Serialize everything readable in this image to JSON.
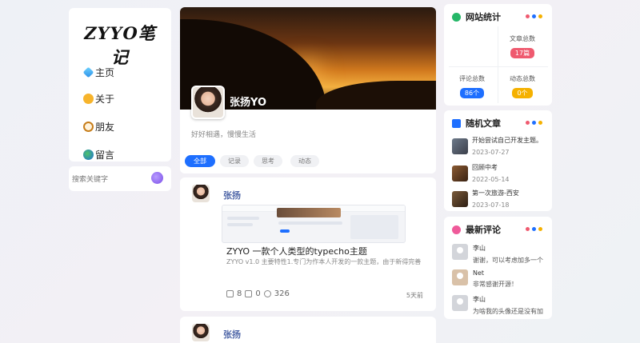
{
  "logo": "ZYYO笔记",
  "nav": [
    {
      "label": "主页",
      "icon": "diamond-icon"
    },
    {
      "label": "关于",
      "icon": "smiley-icon"
    },
    {
      "label": "朋友",
      "icon": "clock-icon"
    },
    {
      "label": "留言",
      "icon": "globe-icon"
    }
  ],
  "search": {
    "placeholder": "搜索关键字"
  },
  "profile": {
    "name": "张扬YO",
    "bio": "好好相遇，慢慢生活"
  },
  "tabs": [
    "全部",
    "记录",
    "思考",
    "动态"
  ],
  "posts": [
    {
      "author": "张扬",
      "title": "ZYYO 一款个人类型的typecho主题",
      "excerpt": "ZYYO v1.0 主要特性1.专门为作本人开发的一款主题，由于新得完善",
      "comments": "8",
      "likes": "0",
      "views": "326",
      "time": "5天前"
    },
    {
      "author": "张扬"
    }
  ],
  "stats": {
    "title": "网站统计",
    "article_label": "文章总数",
    "article_value": "17篇",
    "comment_label": "评论总数",
    "comment_value": "86个",
    "category_label": "动态总数",
    "category_value": "0个"
  },
  "random": {
    "title": "随机文章",
    "items": [
      {
        "title": "开始尝试自己开发主题。",
        "date": "2023-07-27"
      },
      {
        "title": "回顾中考",
        "date": "2022-05-14"
      },
      {
        "title": "第一次旅游-西安",
        "date": "2023-07-18"
      }
    ]
  },
  "comments": {
    "title": "最新评论",
    "items": [
      {
        "name": "李山",
        "text": "谢谢，可以考虑加多一个"
      },
      {
        "name": "Net",
        "text": "非常感谢开源！"
      },
      {
        "name": "李山",
        "text": "为啥我的头像还是没有加"
      }
    ]
  },
  "colors": {
    "accent": "#1e6fff",
    "red": "#ef5a6f",
    "blue": "#1e6fff",
    "yellow": "#f5b100"
  }
}
